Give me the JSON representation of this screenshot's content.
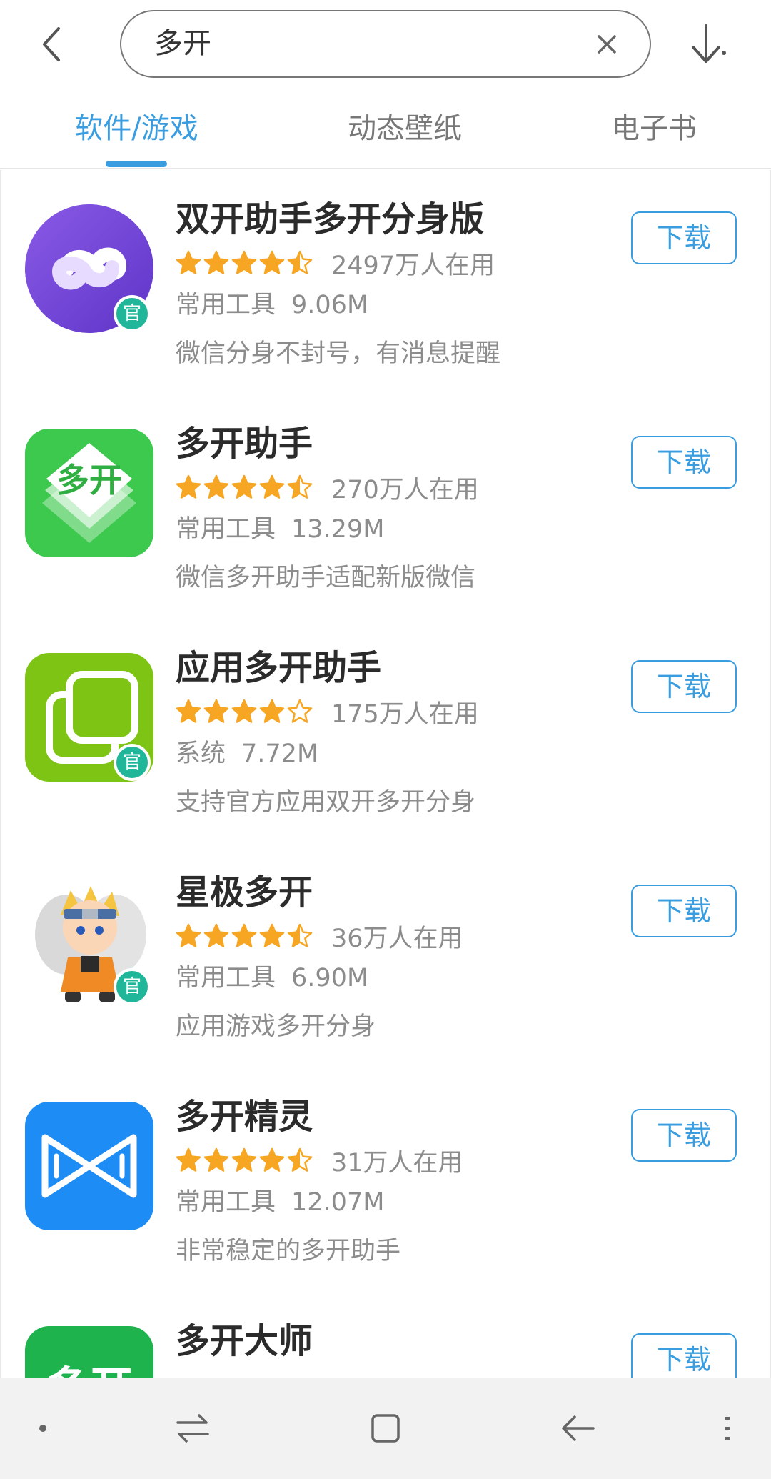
{
  "search": {
    "query": "多开"
  },
  "tabs": [
    {
      "label": "软件/游戏"
    },
    {
      "label": "动态壁纸"
    },
    {
      "label": "电子书"
    }
  ],
  "colors": {
    "accent": "#3a9de0",
    "star": "#f6a623",
    "badge": "#20b69a"
  },
  "apps": [
    {
      "name": "双开助手多开分身版",
      "stars": 4.5,
      "users": "2497万人在用",
      "category": "常用工具",
      "size": "9.06M",
      "desc": "微信分身不封号，有消息提醒",
      "button": "下载",
      "official_badge": "官",
      "icon": "infinity-app-icon"
    },
    {
      "name": "多开助手",
      "stars": 4.5,
      "users": "270万人在用",
      "category": "常用工具",
      "size": "13.29M",
      "desc": "微信多开助手适配新版微信",
      "button": "下载",
      "icon_text": "多开",
      "icon": "duokai-app-icon"
    },
    {
      "name": "应用多开助手",
      "stars": 4.0,
      "users": "175万人在用",
      "category": "系统",
      "size": "7.72M",
      "desc": "支持官方应用双开多开分身",
      "button": "下载",
      "official_badge": "官",
      "icon": "overlapping-squares-app-icon"
    },
    {
      "name": "星极多开",
      "stars": 4.5,
      "users": "36万人在用",
      "category": "常用工具",
      "size": "6.90M",
      "desc": "应用游戏多开分身",
      "button": "下载",
      "official_badge": "官",
      "icon": "ninja-character-app-icon"
    },
    {
      "name": "多开精灵",
      "stars": 4.5,
      "users": "31万人在用",
      "category": "常用工具",
      "size": "12.07M",
      "desc": "非常稳定的多开助手",
      "button": "下载",
      "icon": "bowtie-app-icon"
    },
    {
      "name": "多开大师",
      "button": "下载",
      "icon_text": "多开",
      "icon": "duokai-master-app-icon"
    }
  ],
  "nav": [
    "dot-icon",
    "switch-icon",
    "home-icon",
    "back-icon",
    "menu-icon"
  ]
}
